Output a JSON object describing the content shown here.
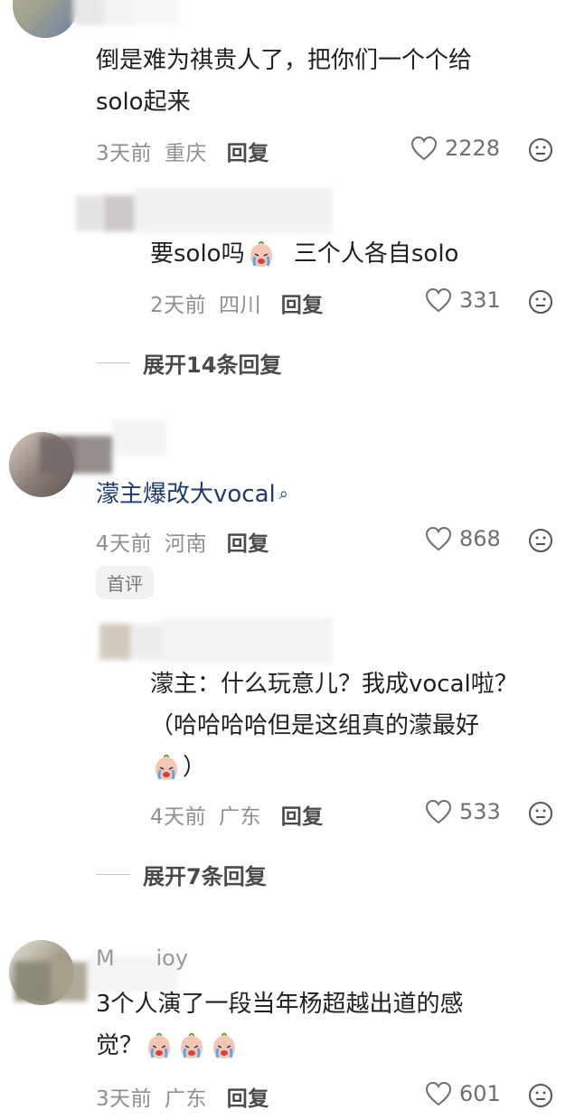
{
  "comments": [
    {
      "text_line1": "倒是难为祺贵人了，把你们一个个给",
      "text_line2": "solo起来",
      "date": "3天前",
      "location": "重庆",
      "reply_label": "回复",
      "likes": "2228"
    },
    {
      "text_line1": "三个人各自solo",
      "text_prefix": "要solo吗",
      "date": "2天前",
      "location": "四川",
      "reply_label": "回复",
      "likes": "331"
    },
    {
      "expand_label": "展开14条回复"
    },
    {
      "text_line1": "濛主爆改大vocal",
      "search_glyph": "ᵒ",
      "date": "4天前",
      "location": "河南",
      "reply_label": "回复",
      "likes": "868",
      "badge": "首评"
    },
    {
      "text_line1": "濛主：什么玩意儿？我成vocal啦？",
      "text_line2": "（哈哈哈哈但是这组真的濛最好",
      "text_line3": "）",
      "date": "4天前",
      "location": "广东",
      "reply_label": "回复",
      "likes": "533"
    },
    {
      "expand_label": "展开7条回复"
    },
    {
      "username_partial": "M      ioy",
      "text_line1": "3个人演了一段当年杨超越出道的感",
      "text_line2": "觉？",
      "date": "3天前",
      "location": "广东",
      "reply_label": "回复",
      "likes": "601"
    }
  ],
  "colors": {
    "meta_gray": "#8f8f8f",
    "link_blue": "#1e3a6e",
    "badge_bg": "#f1f1f1"
  },
  "icons": [
    "heart-icon",
    "emoji-face-icon",
    "crying-emoji-icon",
    "search-icon"
  ]
}
